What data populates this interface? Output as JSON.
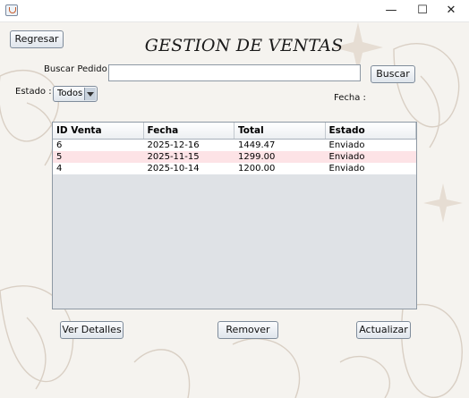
{
  "window": {
    "icon": "java-cup-icon",
    "controls": {
      "minimize": "—",
      "maximize": "☐",
      "close": "✕"
    }
  },
  "header": {
    "back_label": "Regresar",
    "title": "GESTION DE VENTAS"
  },
  "search": {
    "label": "Buscar Pedido :",
    "value": "",
    "button_label": "Buscar"
  },
  "filters": {
    "estado_label": "Estado :",
    "estado_value": "Todos",
    "fecha_label": "Fecha :"
  },
  "table": {
    "columns": [
      "ID Venta",
      "Fecha",
      "Total",
      "Estado"
    ],
    "rows": [
      [
        "6",
        "2025-12-16",
        "1449.47",
        "Enviado"
      ],
      [
        "5",
        "2025-11-15",
        "1299.00",
        "Enviado"
      ],
      [
        "4",
        "2025-10-14",
        "1200.00",
        "Enviado"
      ]
    ],
    "highlight_color": "#fde3e6"
  },
  "actions": {
    "details_label": "Ver Detalles",
    "remove_label": "Remover",
    "refresh_label": "Actualizar"
  }
}
